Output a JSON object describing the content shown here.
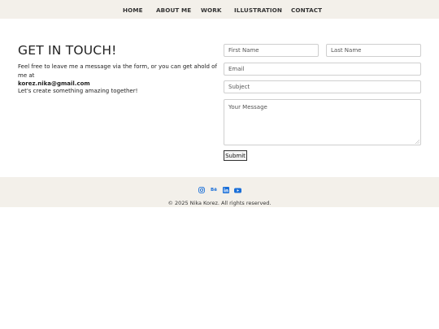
{
  "nav": {
    "items": [
      "HOME",
      "ABOUT ME",
      "WORK",
      "ILLUSTRATION",
      "CONTACT"
    ]
  },
  "contact": {
    "title": "GET IN TOUCH!",
    "intro": "Feel free to leave me a message via the form, or you can get ahold of me at",
    "email": "korez.nika@gmail.com",
    "outro": "Let's create something amazing together!"
  },
  "form": {
    "first_name_placeholder": "First Name",
    "last_name_placeholder": "Last Name",
    "email_placeholder": "Email",
    "subject_placeholder": "Subject",
    "message_placeholder": "Your Message",
    "submit_label": "Submit"
  },
  "footer": {
    "social_icons": [
      "instagram-icon",
      "behance-icon",
      "linkedin-icon",
      "youtube-icon"
    ],
    "behance_text": "Bē",
    "copyright": "© 2025 Nika Korez. All rights reserved."
  },
  "colors": {
    "nav_bg": "#f3f0ea",
    "footer_bg": "#f3f0ea",
    "icon_blue": "#1a6fd8"
  }
}
